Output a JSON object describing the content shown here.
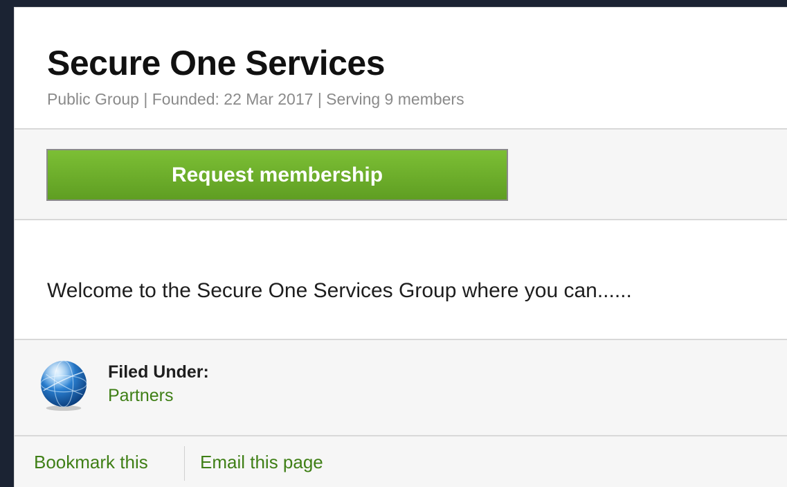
{
  "group": {
    "title": "Secure One Services",
    "meta": "Public Group | Founded: 22 Mar 2017 | Serving 9 members"
  },
  "actions": {
    "request_membership_label": "Request membership"
  },
  "description": {
    "text": "Welcome to the Secure One Services Group where you can......"
  },
  "filed_under": {
    "label": "Filed Under:",
    "category": "Partners",
    "icon": "globe-icon"
  },
  "footer": {
    "bookmark_label": "Bookmark this",
    "email_label": "Email this page"
  },
  "colors": {
    "accent_green": "#6aad2a",
    "link_green": "#3f7f16",
    "background_dark": "#1b2333"
  }
}
